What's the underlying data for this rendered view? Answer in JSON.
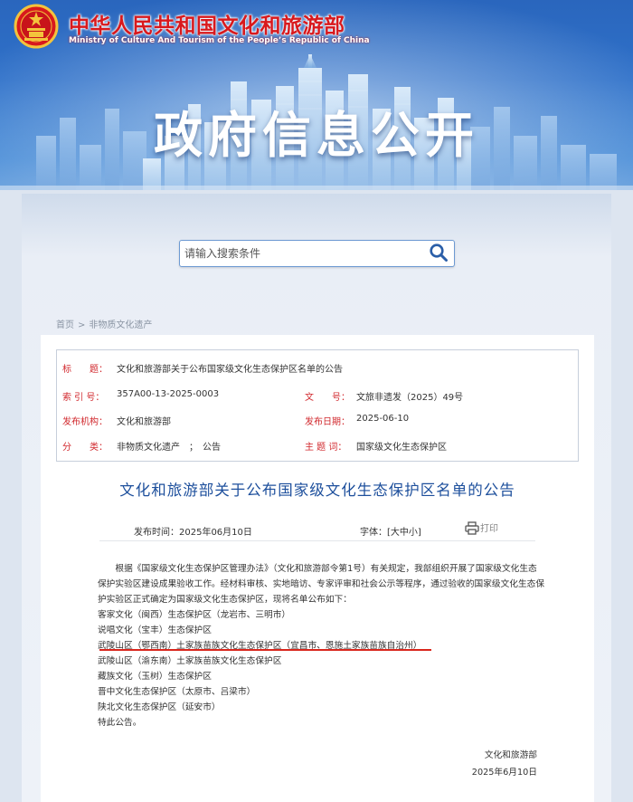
{
  "header": {
    "ministry_cn": "中华人民共和国文化和旅游部",
    "ministry_en": "Ministry of Culture And Tourism of the People’s Republic of China",
    "banner_title": "政府信息公开"
  },
  "search": {
    "placeholder": "请输入搜索条件"
  },
  "breadcrumb": {
    "home": "首页",
    "separator": ">",
    "current": "非物质文化遗产"
  },
  "meta": {
    "title_label": "标　　题：",
    "title_value": "文化和旅游部关于公布国家级文化生态保护区名单的公告",
    "index_label": "索 引 号：",
    "index_value": "357A00-13-2025-0003",
    "docno_label": "文　　号：",
    "docno_value": "文旅非遗发（2025）49号",
    "issuer_label": "发布机构：",
    "issuer_value": "文化和旅游部",
    "date_label": "发布日期：",
    "date_value": "2025-06-10",
    "category_label": "分　　类：",
    "category_value": "非物质文化遗产　；　公告",
    "subject_label": "主 题 词：",
    "subject_value": "国家级文化生态保护区"
  },
  "article": {
    "title": "文化和旅游部关于公布国家级文化生态保护区名单的公告",
    "publish_time": "发布时间：2025年06月10日",
    "font_label": "字体：",
    "font_large": "大",
    "font_medium": "中",
    "font_small": "小",
    "print_label": "打印",
    "paragraph_lines": [
      "根据《国家级文化生态保护区管理办法》（文化和旅游部令第1号）有关规定，我部组织开展了国家级文化生态",
      "保护实验区建设成果验收工作。经材料审核、实地暗访、专家评审和社会公示等程序，通过验收的国家级文化生态保",
      "护实验区正式确定为国家级文化生态保护区，现将名单公布如下："
    ],
    "list": [
      "客家文化（闽西）生态保护区（龙岩市、三明市）",
      "说唱文化（宝丰）生态保护区",
      "武陵山区（鄂西南）土家族苗族文化生态保护区（宜昌市、恩施土家族苗族自治州）",
      "武陵山区（渝东南）土家族苗族文化生态保护区",
      "藏族文化（玉树）生态保护区",
      "晋中文化生态保护区（太原市、吕梁市）",
      "陕北文化生态保护区（延安市）",
      "特此公告。"
    ],
    "signature": "文化和旅游部",
    "signature_date": "2025年6月10日"
  },
  "colors": {
    "banner_blue": "#2f71c9",
    "ministry_red": "#d8191d",
    "label_red": "#d1282d",
    "title_blue": "#1d4f9c",
    "highlight_red": "#d9261c"
  }
}
